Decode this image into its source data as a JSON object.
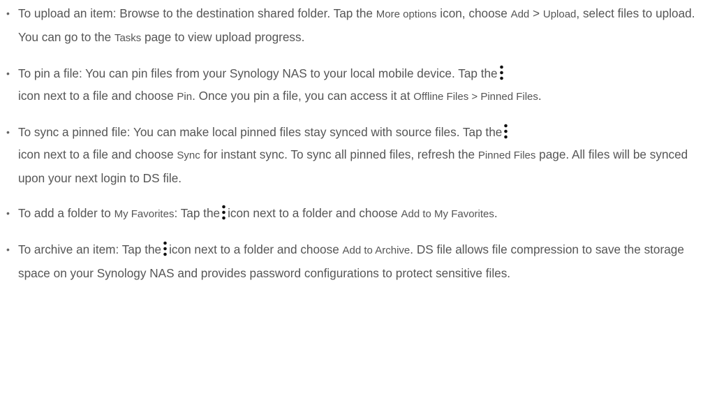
{
  "bullet": "•",
  "items": [
    {
      "t0": "To upload an item: Browse to the destination shared folder. Tap the ",
      "u0": "More options",
      "t1": " icon, choose ",
      "u1": "Add",
      "t2": " > ",
      "u2": "Upload",
      "t3": ", select files to upload. You can go to the ",
      "u3": "Tasks",
      "t4": " page to view upload progress."
    },
    {
      "t0": "To pin a file: You can pin files from your Synology NAS to your local mobile device. Tap the",
      "icon": "more-options-icon",
      "t1": "icon next to a file and choose ",
      "u0": "Pin",
      "t2": ". Once you pin a file, you can access it at ",
      "u1": "Offline Files",
      "t3": " > ",
      "u2": "Pinned Files",
      "t4": "."
    },
    {
      "t0": "To sync a pinned file: You can make local pinned files stay synced with source files. Tap the",
      "icon": "more-options-icon",
      "t1": "icon next to a file and choose ",
      "u0": "Sync",
      "t2": " for instant sync. To sync all pinned files, refresh the ",
      "u1": "Pinned Files",
      "t3": " page. All files will be synced upon your next login to DS file."
    },
    {
      "t0": "To add a folder to ",
      "u0": "My Favorites",
      "t1": ": Tap the",
      "icon": "more-options-icon",
      "t2": "icon next to a folder and choose ",
      "u1": "Add to My Favorites",
      "t3": "."
    },
    {
      "t0": "To archive an item: Tap the",
      "icon": "more-options-icon",
      "t1": "icon next to a folder and choose ",
      "u0": "Add to Archive",
      "t2": ". DS file allows file compression to save the storage space on your Synology NAS and provides password configurations to protect sensitive files."
    }
  ]
}
